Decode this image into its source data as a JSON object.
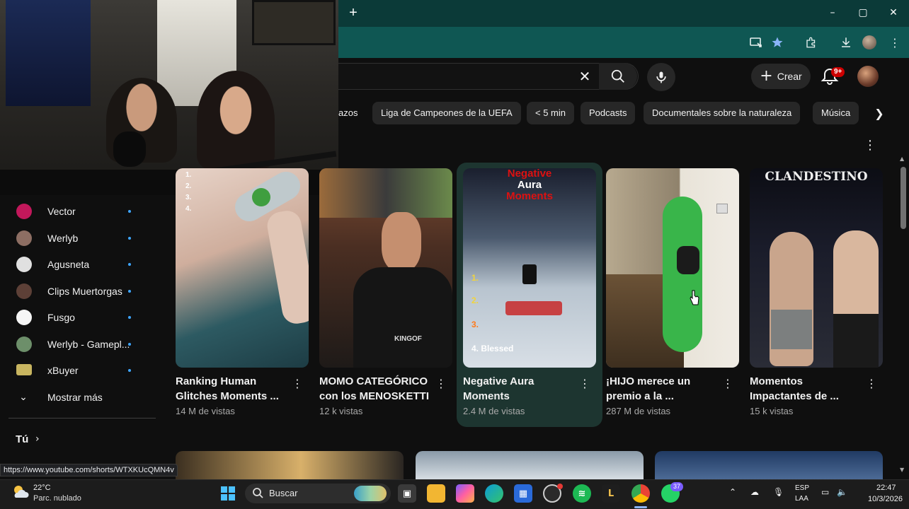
{
  "browser": {
    "window_controls": {
      "minimize": "–",
      "maximize": "▢",
      "close": "✕"
    },
    "new_tab_symbol": "+"
  },
  "header": {
    "clear_symbol": "✕",
    "create_label": "Crear",
    "notification_badge": "9+"
  },
  "chips": [
    "azos",
    "Liga de Campeones de la UEFA",
    "< 5 min",
    "Podcasts",
    "Documentales sobre la naturaleza",
    "Música"
  ],
  "sidebar": {
    "subscriptions": [
      {
        "name": "Vector",
        "color": "#c2185b"
      },
      {
        "name": "Werlyb",
        "color": "#8d6e63"
      },
      {
        "name": "Agusneta",
        "color": "#e0e0e0"
      },
      {
        "name": "Clips Muertorgas",
        "color": "#5d4037"
      },
      {
        "name": "Fusgo",
        "color": "#f5f5f5"
      },
      {
        "name": "Werlyb - Gamepl...",
        "color": "#6d8f6a"
      },
      {
        "name": "xBuyer",
        "color": "#c8b560"
      }
    ],
    "show_more": "Mostrar más",
    "you_section": "Tú"
  },
  "shorts": [
    {
      "title": "Ranking Human Glitches Moments ...",
      "views": "14 M de vistas",
      "overlay": [
        "1.",
        "2.",
        "3.",
        "4."
      ]
    },
    {
      "title": "MOMO CATEGÓRICO con los MENOSKETTI",
      "views": "12 k vistas",
      "overlay": [
        "KINGOF"
      ]
    },
    {
      "title": "Negative Aura Moments",
      "views": "2.4 M de vistas",
      "overlay": [
        "Negative",
        "Aura",
        "Moments",
        "1.",
        "2.",
        "3.",
        "4. Blessed"
      ]
    },
    {
      "title": "¡HIJO merece un premio a la ...",
      "views": "287 M de vistas",
      "overlay": []
    },
    {
      "title": "Momentos Impactantes de ...",
      "views": "15 k vistas",
      "overlay": [
        "CLANDESTINO"
      ]
    }
  ],
  "status_url": "https://www.youtube.com/shorts/WTXKUcQMN4v",
  "taskbar": {
    "weather_temp": "22°C",
    "weather_desc": "Parc. nublado",
    "search_label": "Buscar",
    "whatsapp_badge": "37",
    "lang_line1": "ESP",
    "lang_line2": "LAA",
    "time": "22:47",
    "date": "10/3/2026"
  },
  "colors": {
    "chrome_title": "#0b3a38",
    "chrome_toolbar": "#0f5753",
    "yt_background": "#0f0f0f",
    "chip_background": "#272727",
    "accent_red": "#cc0000",
    "subscription_dot": "#3ea6ff"
  }
}
